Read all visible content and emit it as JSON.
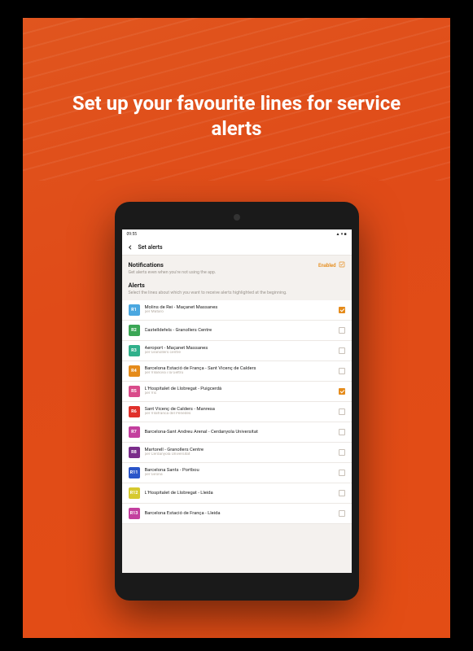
{
  "headline": "Set up your favourite lines for service alerts",
  "tablet": {
    "status": {
      "time": "09:55",
      "icons": "▲ ▾ ■"
    },
    "title_bar": {
      "title": "Set alerts"
    },
    "notifications": {
      "title": "Notifications",
      "subtitle": "Get alerts even when you're not using the app.",
      "enabled_label": "Enabled"
    },
    "alerts": {
      "title": "Alerts",
      "subtitle": "Select the lines about which you want to receive alerts highlighted at the beginning."
    },
    "line_colors": {
      "R1": "#4aa7e0",
      "R2": "#3aa655",
      "R3": "#30b08b",
      "R4": "#e58b1a",
      "R5": "#d94b8a",
      "R6": "#e0302b",
      "R7": "#c33f9e",
      "R8": "#7a2d8a",
      "R11": "#2a55c9",
      "R12": "#d6c92e",
      "R13": "#c33f9e"
    },
    "lines": [
      {
        "code": "R1",
        "route": "Molins de Rei - Maçanet Massanes",
        "operator": "per Mataró",
        "checked": true
      },
      {
        "code": "R2",
        "route": "Castelldefels - Granollers Centre",
        "operator": "",
        "checked": false
      },
      {
        "code": "R3",
        "route": "Aeroport - Maçanet Massanes",
        "operator": "per Granollers centre",
        "checked": false
      },
      {
        "code": "R4",
        "route": "Barcelona Estació de França - Sant Vicenç de Calders",
        "operator": "per Vilanova i la Geltrú",
        "checked": false
      },
      {
        "code": "R5",
        "route": "L'Hospitalet de Llobregat - Puigcerdà",
        "operator": "per Vic",
        "checked": true
      },
      {
        "code": "R6",
        "route": "Sant Vicenç de Calders - Manresa",
        "operator": "per Vilafranca del Penedès",
        "checked": false
      },
      {
        "code": "R7",
        "route": "Barcelona-Sant Andreu Arenal - Cerdanyola Universitat",
        "operator": "",
        "checked": false
      },
      {
        "code": "R8",
        "route": "Martorell - Granollers Centre",
        "operator": "per Cerdanyola Universitat",
        "checked": false
      },
      {
        "code": "R11",
        "route": "Barcelona Sants - Portbou",
        "operator": "per Girona",
        "checked": false
      },
      {
        "code": "R12",
        "route": "L'Hospitalet de Llobregat - Lleida",
        "operator": "",
        "checked": false
      },
      {
        "code": "R13",
        "route": "Barcelona Estació de França - Lleida",
        "operator": "",
        "checked": false
      }
    ]
  }
}
